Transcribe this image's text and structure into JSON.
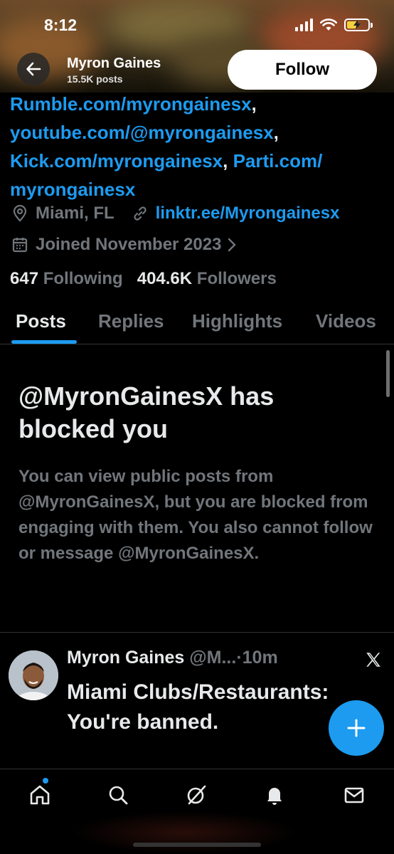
{
  "status_bar": {
    "time": "8:12"
  },
  "header": {
    "name": "Myron Gaines",
    "posts_count": "15.5K posts",
    "follow_label": "Follow"
  },
  "bio": {
    "link1": "Rumble.com/myrongainesx",
    "sep1": ",",
    "link2": "youtube.com/@myrongainesx",
    "sep2": ",",
    "link3": "Kick.com/myrongainesx",
    "sep3": ", ",
    "link4a": "Parti.com/",
    "link4b": "myrongainesx"
  },
  "meta": {
    "location": "Miami, FL",
    "website": "linktr.ee/Myrongainesx",
    "joined": "Joined November 2023"
  },
  "counts": {
    "following_num": "647",
    "following_label": "Following",
    "followers_num": "404.6K",
    "followers_label": "Followers"
  },
  "tabs": [
    "Posts",
    "Replies",
    "Highlights",
    "Videos"
  ],
  "blocked": {
    "title": "@MyronGainesX has blocked you",
    "description": "You can view public posts from @MyronGainesX, but you are blocked from engaging with them. You also cannot follow or message @MyronGainesX."
  },
  "post": {
    "name": "Myron Gaines",
    "handle": "@M...",
    "time": "·10m",
    "text": "Miami Clubs/Restaurants: You're banned."
  },
  "colors": {
    "accent": "#1d9bf0",
    "muted": "#71767b",
    "text": "#e7e9ea",
    "background": "#000000"
  },
  "icons": {
    "back": "arrow-left-icon",
    "location": "location-pin-icon",
    "link": "link-icon",
    "calendar": "calendar-icon",
    "x_logo": "x-logo-icon",
    "compose": "plus-icon",
    "nav": [
      "home-icon",
      "search-icon",
      "grok-icon",
      "notifications-icon",
      "messages-icon"
    ]
  }
}
